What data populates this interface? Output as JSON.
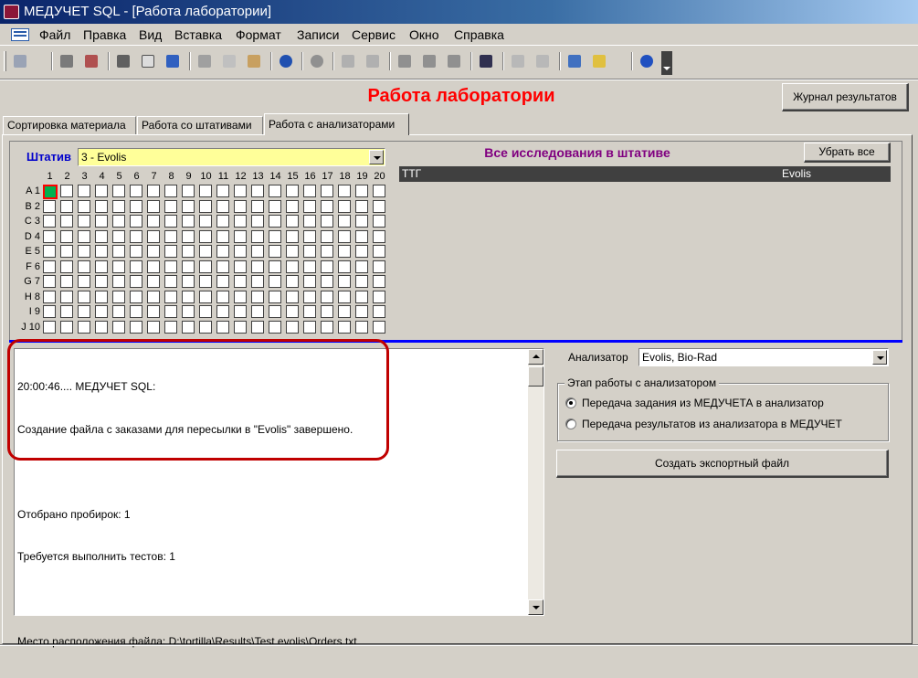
{
  "window": {
    "title": "МЕДУЧЕТ SQL - [Работа лаборатории]"
  },
  "menu": [
    "Файл",
    "Правка",
    "Вид",
    "Вставка",
    "Формат",
    "Записи",
    "Сервис",
    "Окно",
    "Справка"
  ],
  "toolbar_icons": [
    "design-view-icon",
    "save-icon",
    "print-preview-doc-icon",
    "print-icon",
    "preview-icon",
    "spellcheck-icon",
    "cut-icon",
    "copy-icon",
    "paste-icon",
    "undo-icon",
    "hyperlink-icon",
    "sort-asc-icon",
    "sort-desc-icon",
    "filter-selection-icon",
    "filter-form-icon",
    "apply-filter-icon",
    "find-icon",
    "new-record-icon",
    "delete-record-icon",
    "database-window-icon",
    "new-object-icon",
    "help-icon"
  ],
  "form": {
    "title": "Работа лаборатории",
    "journal_button": "Журнал результатов",
    "tabs": [
      "Сортировка материала",
      "Работа со штативами",
      "Работа с анализаторами"
    ],
    "active_tab": 2
  },
  "rack": {
    "label": "Штатив",
    "value": "3 - Evolis",
    "columns": [
      "1",
      "2",
      "3",
      "4",
      "5",
      "6",
      "7",
      "8",
      "9",
      "10",
      "11",
      "12",
      "13",
      "14",
      "15",
      "16",
      "17",
      "18",
      "19",
      "20"
    ],
    "rows": [
      "A 1",
      "B 2",
      "C 3",
      "D 4",
      "E 5",
      "F 6",
      "G 7",
      "H 8",
      "I 9",
      "J 10"
    ],
    "selected_cell": "A1"
  },
  "studies": {
    "title": "Все исследования в штативе",
    "clear_button": "Убрать все",
    "rows": [
      {
        "name": "ТТГ",
        "analyzer": "Evolis"
      }
    ]
  },
  "log": {
    "lines": [
      "20:00:46.... МЕДУЧЕТ SQL:",
      "Создание файла с заказами для пересылки в \"Evolis\" завершено.",
      "",
      "Отобрано пробирок: 1",
      "Требуется выполнить тестов: 1",
      "",
      "Место расположения файла: D:\\tortilla\\Results\\Test evolis\\Orders.txt"
    ]
  },
  "analyzer": {
    "label": "Анализатор",
    "value": "Evolis, Bio-Rad",
    "stage_title": "Этап работы с анализатором",
    "options": [
      {
        "label": "Передача задания из МЕДУЧЕТА в анализатор",
        "checked": true
      },
      {
        "label": "Передача результатов из анализатора в МЕДУЧЕТ",
        "checked": false
      }
    ],
    "export_button": "Создать экспортный файл"
  }
}
